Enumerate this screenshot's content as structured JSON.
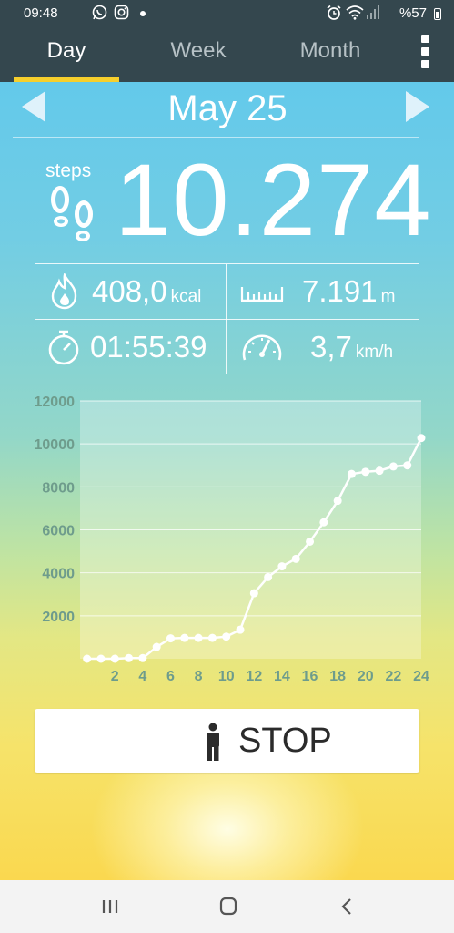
{
  "status_bar": {
    "time": "09:48",
    "battery": "%57",
    "icons": [
      "whatsapp-icon",
      "instagram-icon",
      "dot-icon",
      "alarm-icon",
      "wifi-icon",
      "signal-icon",
      "battery-icon"
    ]
  },
  "tabs": [
    {
      "label": "Day",
      "active": true
    },
    {
      "label": "Week",
      "active": false
    },
    {
      "label": "Month",
      "active": false
    }
  ],
  "date": "May 25",
  "steps": {
    "label": "steps",
    "value": "10.274"
  },
  "stats": {
    "calories": {
      "value": "408,0",
      "unit": "kcal",
      "icon": "flame-icon"
    },
    "distance": {
      "value": "7.191",
      "unit": "m",
      "icon": "ruler-icon"
    },
    "duration": {
      "value": "01:55:39",
      "icon": "stopwatch-icon"
    },
    "speed": {
      "value": "3,7",
      "unit": "km/h",
      "icon": "speedometer-icon"
    }
  },
  "chart_data": {
    "type": "line",
    "title": "",
    "xlabel": "",
    "ylabel": "",
    "x": [
      0,
      1,
      2,
      3,
      4,
      5,
      6,
      7,
      8,
      9,
      10,
      11,
      12,
      13,
      14,
      15,
      16,
      17,
      18,
      19,
      20,
      21,
      22,
      23,
      24
    ],
    "values": [
      0,
      0,
      0,
      30,
      30,
      550,
      950,
      970,
      970,
      970,
      1030,
      1350,
      3050,
      3800,
      4300,
      4650,
      5450,
      6350,
      7350,
      8600,
      8700,
      8750,
      8950,
      9000,
      10274
    ],
    "x_ticks": [
      "2",
      "4",
      "6",
      "8",
      "10",
      "12",
      "14",
      "16",
      "18",
      "20",
      "22",
      "24"
    ],
    "y_ticks": [
      "2000",
      "4000",
      "6000",
      "8000",
      "10000",
      "12000"
    ],
    "xlim": [
      -0.5,
      24
    ],
    "ylim": [
      0,
      12000
    ],
    "grid": true,
    "colors": {
      "line": "#ffffff",
      "axis_labels": "#6e9c8c"
    }
  },
  "stop_button": {
    "label": "STOP",
    "icon": "person-icon"
  },
  "nav_bar": {
    "buttons": [
      {
        "name": "recents",
        "icon": "recents-icon"
      },
      {
        "name": "home",
        "icon": "home-icon"
      },
      {
        "name": "back",
        "icon": "back-icon"
      }
    ]
  },
  "colors": {
    "header_bg": "#34474e",
    "tab_indicator": "#f6cf2c",
    "sky_top": "#5bc7ee",
    "sun_bottom": "#fad84f"
  }
}
